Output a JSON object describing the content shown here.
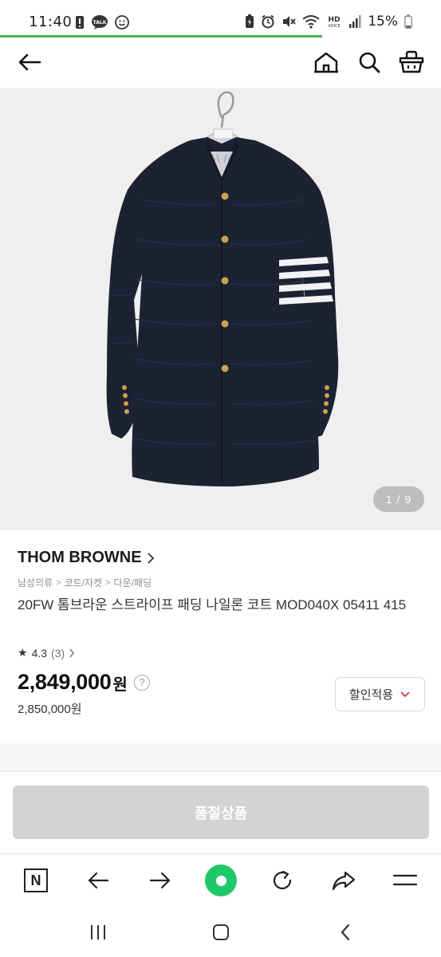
{
  "status": {
    "time": "11:40",
    "battery": "15%"
  },
  "header": {
    "back_icon": "back-arrow-icon",
    "home_icon": "home-icon",
    "search_icon": "search-icon",
    "cart_icon": "cart-icon"
  },
  "image": {
    "counter": "1 / 9"
  },
  "product": {
    "brand": "THOM BROWNE",
    "breadcrumb": [
      "남성의류",
      "코트/자켓",
      "다운/패딩"
    ],
    "title": "20FW 톰브라운 스트라이프 패딩 나일론 코트 MOD040X 05411 415",
    "rating": "4.3",
    "review_count": "(3)",
    "price": "2,849,000",
    "price_unit": "원",
    "original_price": "2,850,000원",
    "discount_label": "할인적용"
  },
  "action": {
    "soldout_label": "품절상품"
  },
  "toolbar": {
    "n_label": "N"
  },
  "colors": {
    "accent_green": "#1ec86a",
    "progress_green": "#4caf50",
    "soldout_gray": "#d3d3d3"
  }
}
